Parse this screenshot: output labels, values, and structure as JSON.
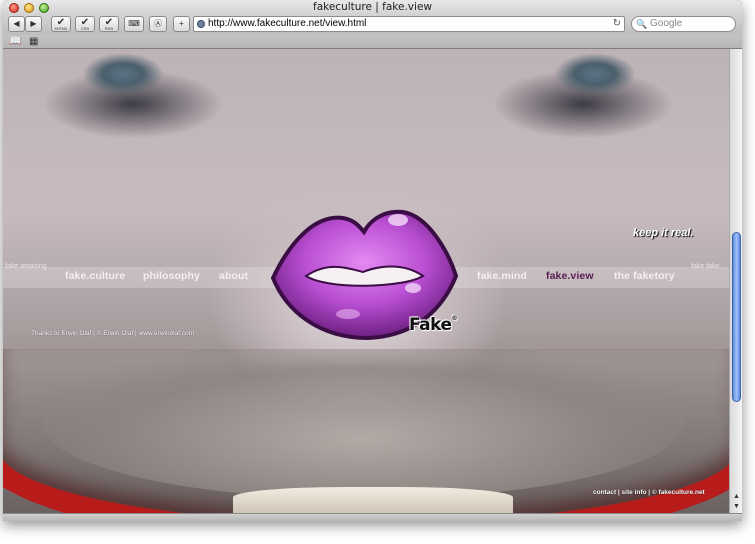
{
  "window": {
    "title": "fakeculture | fake.view"
  },
  "toolbar": {
    "back_label": "◀",
    "forward_label": "▶",
    "xhtml_caption": "XHTML",
    "css_caption": "CSS",
    "rss_caption": "RSS",
    "add_label": "+",
    "url": "http://www.fakeculture.net/view.html",
    "search_placeholder": "Google"
  },
  "nav": {
    "items": [
      {
        "label": "fake.culture"
      },
      {
        "label": "philosophy"
      },
      {
        "label": "about"
      },
      {
        "label": "fake.mind"
      },
      {
        "label": "fake.view"
      },
      {
        "label": "the faketory"
      }
    ],
    "ghost_left": "fake      amazing",
    "ghost_right": "fake              fake"
  },
  "brand": {
    "logo_text": "Fake",
    "registered": "®",
    "tagline": "keep it real."
  },
  "credit": "Thanks to Erwin Olaf | © Erwin Olaf | www.erwinolaf.com",
  "footer": "contact | site info | © fakeculture.net",
  "colors": {
    "lips": "#b94fd2",
    "nav_active": "#5b1d55",
    "scroll_thumb": "#6f9ae4"
  }
}
